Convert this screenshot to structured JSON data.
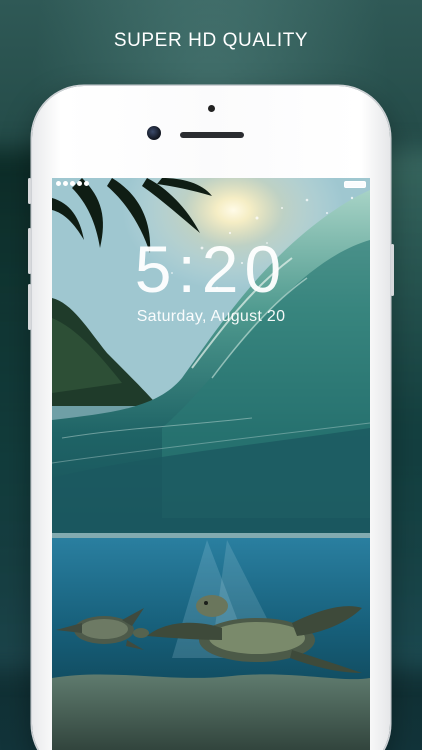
{
  "headline": "SUPER HD QUALITY",
  "lockscreen": {
    "time": "5:20",
    "date": "Saturday, August 20"
  },
  "status_bar": {
    "signal_dots": 5,
    "battery_level": 1.0
  },
  "icons": [
    "signal-dots-icon",
    "battery-icon"
  ],
  "colors": {
    "headline": "#ffffff",
    "phone_body": "#f7f8f9",
    "background": "#1e4441"
  }
}
